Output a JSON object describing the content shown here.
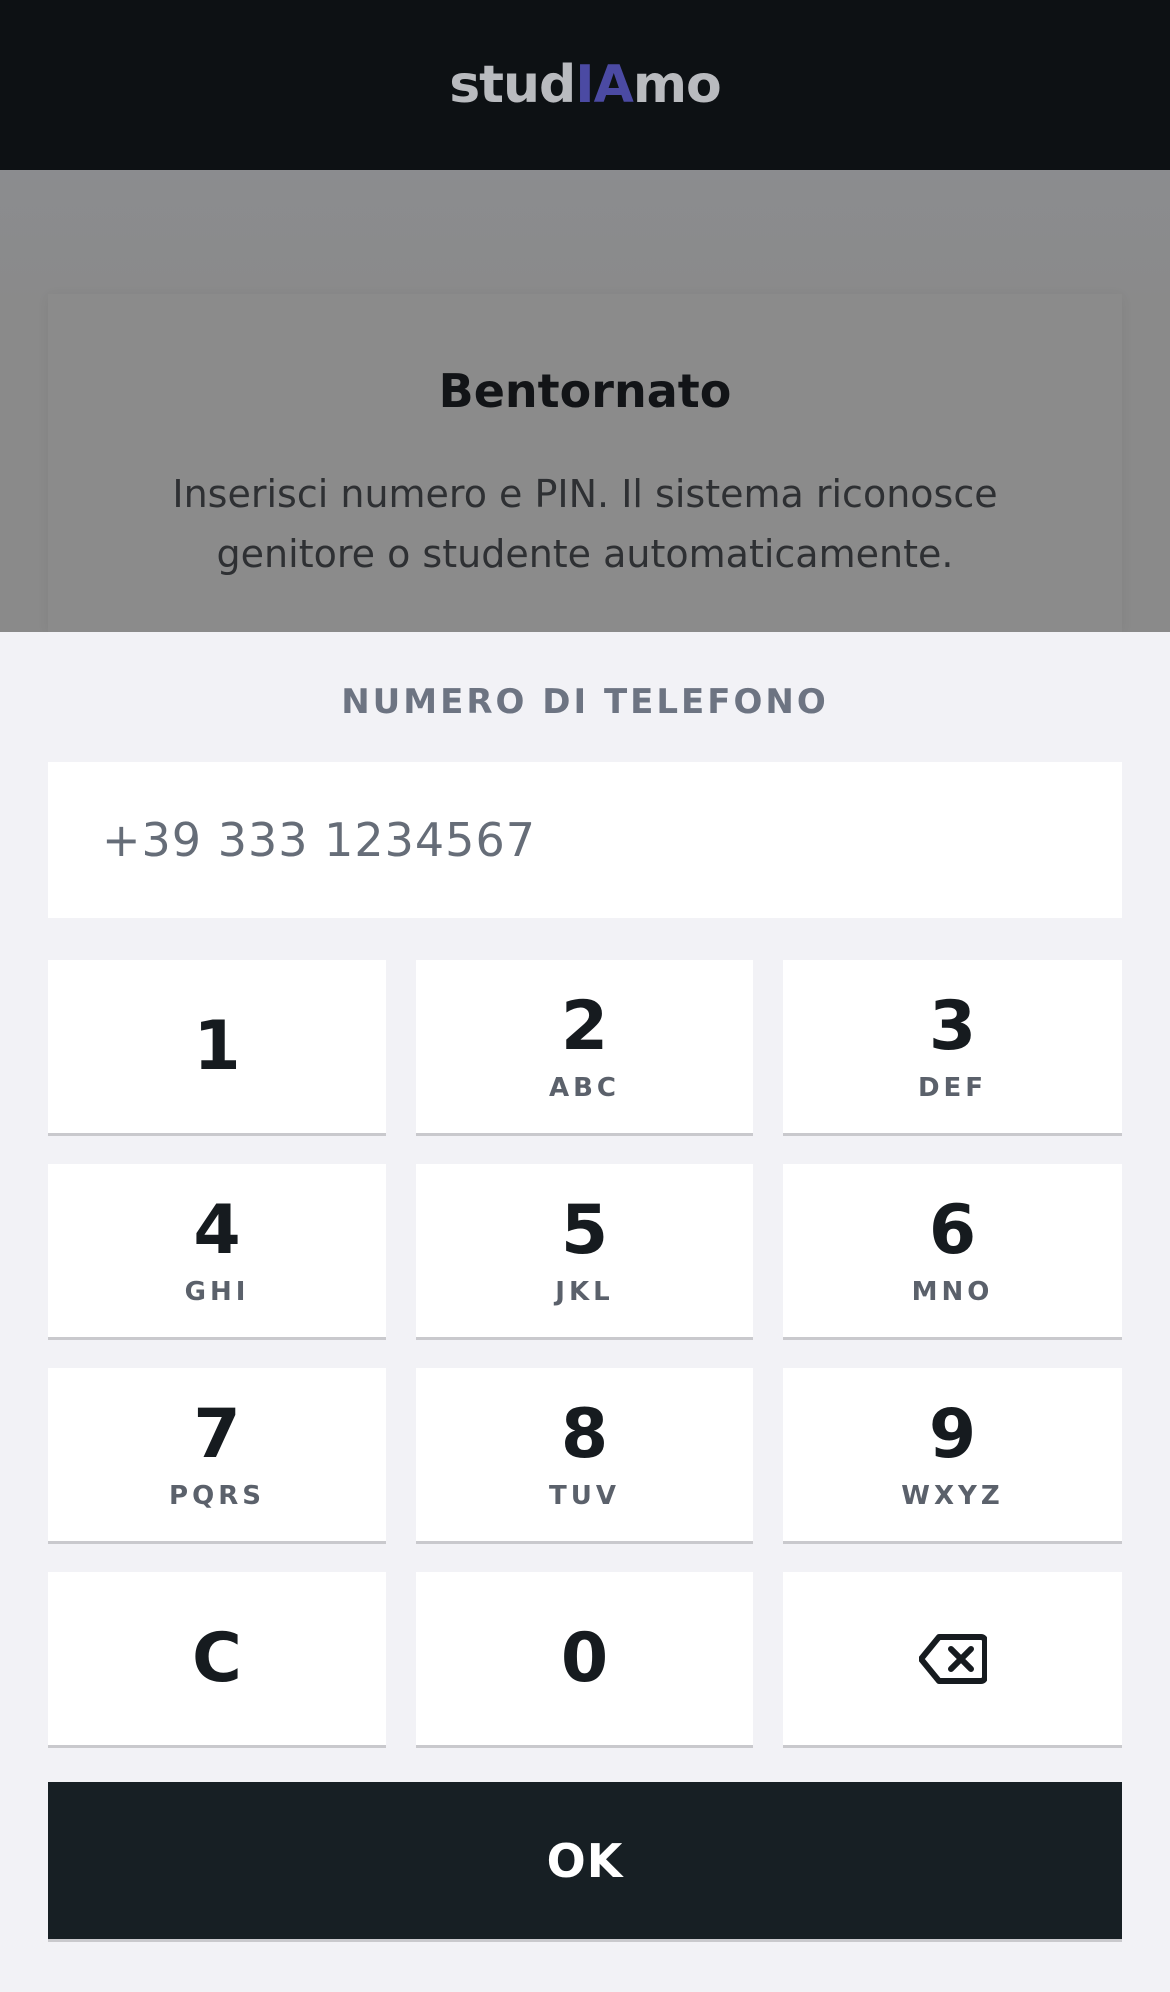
{
  "header": {
    "logo_prefix": "stud",
    "logo_accent": "IA",
    "logo_suffix": "mo"
  },
  "card": {
    "title": "Bentornato",
    "subtitle": "Inserisci numero e PIN. Il sistema riconosce genitore o studente automaticamente."
  },
  "form": {
    "phone_label": "NUMERO DI TELEFONO",
    "phone_placeholder": "+39 333 1234567"
  },
  "keypad": {
    "keys": [
      {
        "num": "1",
        "letters": ""
      },
      {
        "num": "2",
        "letters": "ABC"
      },
      {
        "num": "3",
        "letters": "DEF"
      },
      {
        "num": "4",
        "letters": "GHI"
      },
      {
        "num": "5",
        "letters": "JKL"
      },
      {
        "num": "6",
        "letters": "MNO"
      },
      {
        "num": "7",
        "letters": "PQRS"
      },
      {
        "num": "8",
        "letters": "TUV"
      },
      {
        "num": "9",
        "letters": "WXYZ"
      },
      {
        "num": "C",
        "letters": ""
      },
      {
        "num": "0",
        "letters": ""
      }
    ],
    "backspace_icon": "backspace-icon",
    "ok_label": "OK"
  },
  "colors": {
    "accent": "#4b4aa3",
    "topbar": "#0d1114",
    "ok_button": "#171f24",
    "sheet": "#f2f2f6"
  }
}
